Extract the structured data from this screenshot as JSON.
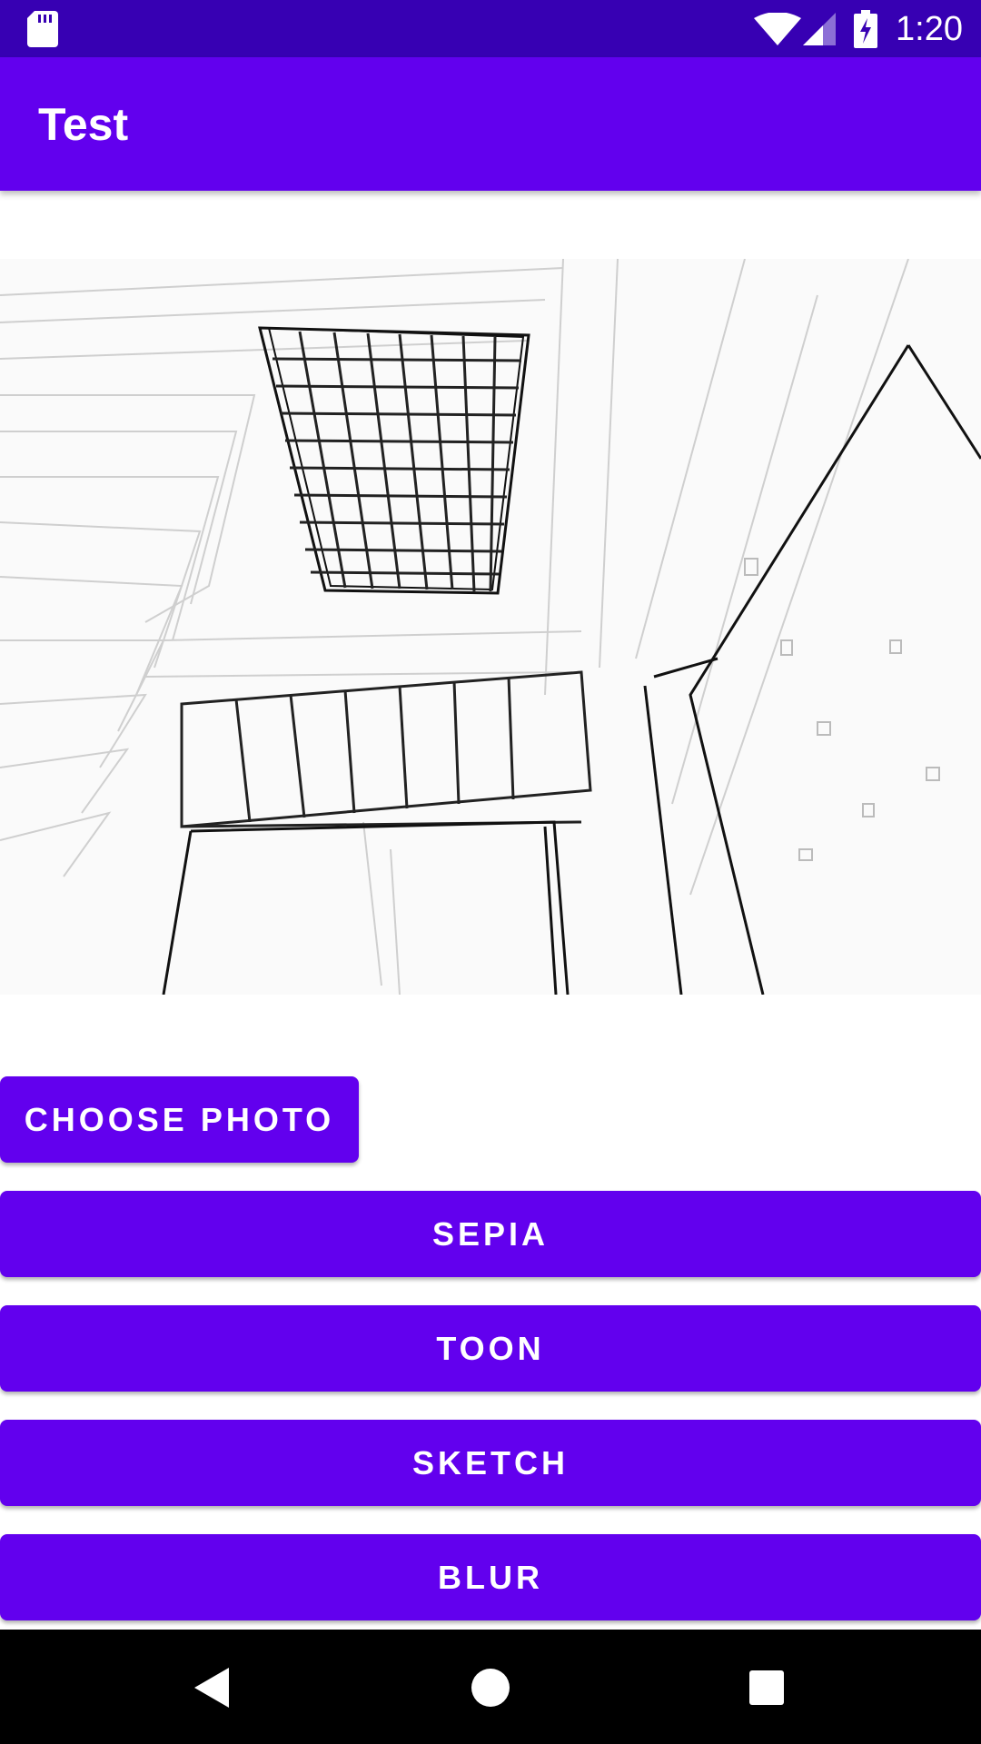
{
  "status_bar": {
    "time": "1:20",
    "icons": [
      "sd-card-icon",
      "wifi-icon",
      "cell-signal-icon",
      "battery-charging-icon"
    ],
    "background": "#3700b3"
  },
  "app_bar": {
    "title": "Test",
    "background": "#6200ee"
  },
  "image": {
    "icon": "sketch-photo"
  },
  "buttons": {
    "choose_photo": "CHOOSE PHOTO",
    "sepia": "SEPIA",
    "toon": "TOON",
    "sketch": "SKETCH",
    "blur": "BLUR"
  },
  "nav_bar": {
    "icons": [
      "back-icon",
      "home-icon",
      "recents-icon"
    ]
  },
  "colors": {
    "accent": "#6200ee",
    "status": "#3700b3"
  }
}
